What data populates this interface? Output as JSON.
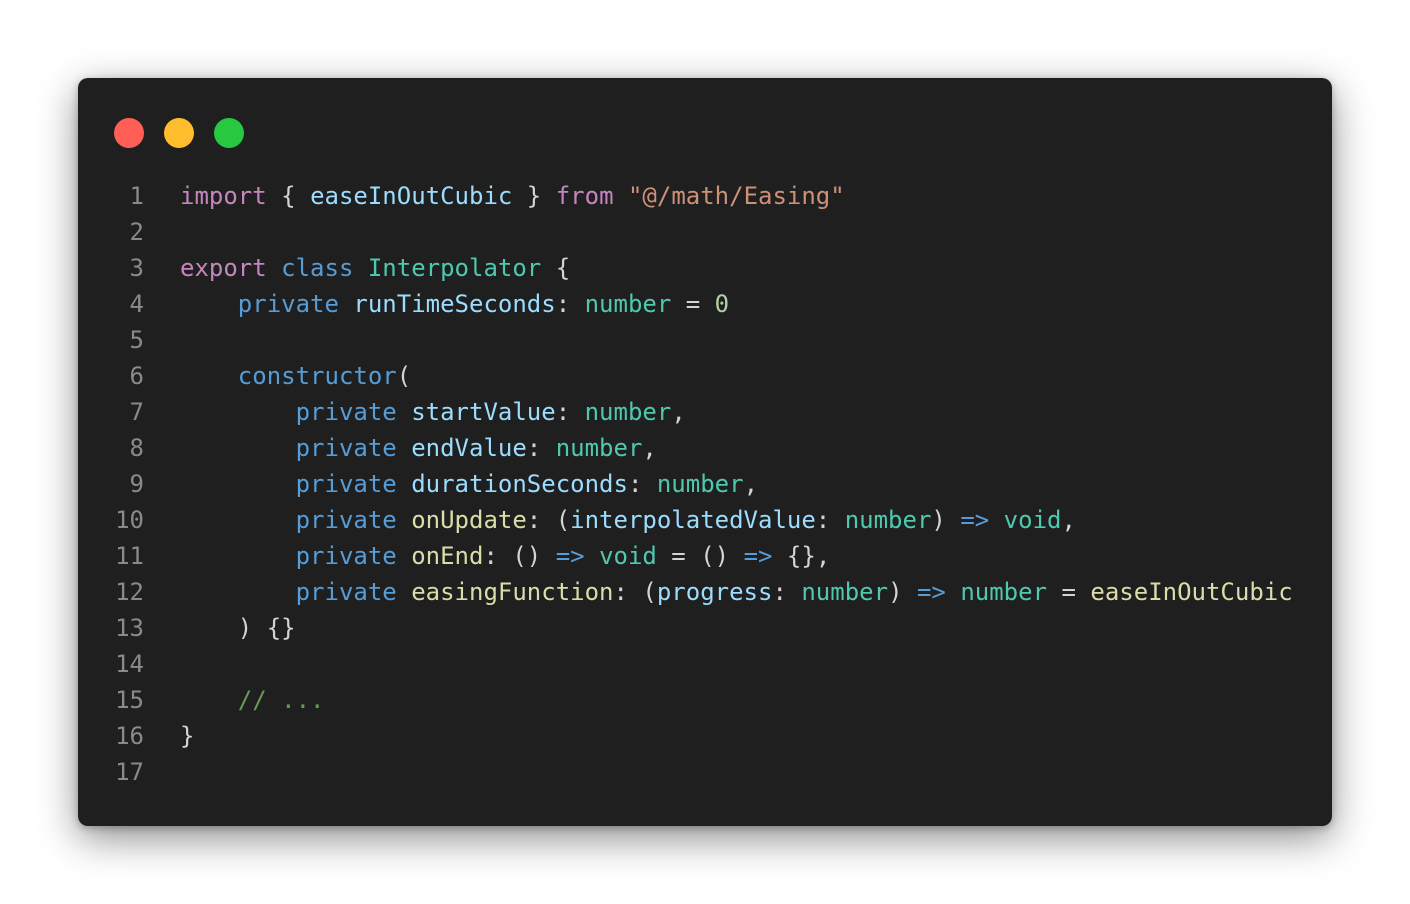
{
  "window_controls": [
    {
      "name": "close",
      "color": "#ff5f57"
    },
    {
      "name": "minimize",
      "color": "#ffbd2e"
    },
    {
      "name": "maximize",
      "color": "#28c840"
    }
  ],
  "colors": {
    "background": "#1f1f1f",
    "line_number": "#8a8a8a",
    "keyword_purple": "#c586c0",
    "keyword_blue": "#569cd6",
    "type_teal": "#4ec9b0",
    "variable": "#9cdcfe",
    "function": "#dcdcaa",
    "string": "#ce9178",
    "number": "#b5cea8",
    "comment": "#6a9955",
    "punctuation": "#d4d4d4"
  },
  "code_lines": [
    {
      "number": "1",
      "tokens": [
        {
          "text": "import",
          "color": "#c586c0"
        },
        {
          "text": " { ",
          "color": "#d4d4d4"
        },
        {
          "text": "easeInOutCubic",
          "color": "#9cdcfe"
        },
        {
          "text": " } ",
          "color": "#d4d4d4"
        },
        {
          "text": "from",
          "color": "#c586c0"
        },
        {
          "text": " ",
          "color": "#d4d4d4"
        },
        {
          "text": "\"@/math/Easing\"",
          "color": "#ce9178"
        }
      ]
    },
    {
      "number": "2",
      "tokens": []
    },
    {
      "number": "3",
      "tokens": [
        {
          "text": "export",
          "color": "#c586c0"
        },
        {
          "text": " ",
          "color": "#d4d4d4"
        },
        {
          "text": "class",
          "color": "#569cd6"
        },
        {
          "text": " ",
          "color": "#d4d4d4"
        },
        {
          "text": "Interpolator",
          "color": "#4ec9b0"
        },
        {
          "text": " {",
          "color": "#d4d4d4"
        }
      ]
    },
    {
      "number": "4",
      "tokens": [
        {
          "text": "    ",
          "color": "#d4d4d4"
        },
        {
          "text": "private",
          "color": "#569cd6"
        },
        {
          "text": " ",
          "color": "#d4d4d4"
        },
        {
          "text": "runTimeSeconds",
          "color": "#9cdcfe"
        },
        {
          "text": ": ",
          "color": "#d4d4d4"
        },
        {
          "text": "number",
          "color": "#4ec9b0"
        },
        {
          "text": " = ",
          "color": "#d4d4d4"
        },
        {
          "text": "0",
          "color": "#b5cea8"
        }
      ]
    },
    {
      "number": "5",
      "tokens": []
    },
    {
      "number": "6",
      "tokens": [
        {
          "text": "    ",
          "color": "#d4d4d4"
        },
        {
          "text": "constructor",
          "color": "#569cd6"
        },
        {
          "text": "(",
          "color": "#d4d4d4"
        }
      ]
    },
    {
      "number": "7",
      "tokens": [
        {
          "text": "        ",
          "color": "#d4d4d4"
        },
        {
          "text": "private",
          "color": "#569cd6"
        },
        {
          "text": " ",
          "color": "#d4d4d4"
        },
        {
          "text": "startValue",
          "color": "#9cdcfe"
        },
        {
          "text": ": ",
          "color": "#d4d4d4"
        },
        {
          "text": "number",
          "color": "#4ec9b0"
        },
        {
          "text": ",",
          "color": "#d4d4d4"
        }
      ]
    },
    {
      "number": "8",
      "tokens": [
        {
          "text": "        ",
          "color": "#d4d4d4"
        },
        {
          "text": "private",
          "color": "#569cd6"
        },
        {
          "text": " ",
          "color": "#d4d4d4"
        },
        {
          "text": "endValue",
          "color": "#9cdcfe"
        },
        {
          "text": ": ",
          "color": "#d4d4d4"
        },
        {
          "text": "number",
          "color": "#4ec9b0"
        },
        {
          "text": ",",
          "color": "#d4d4d4"
        }
      ]
    },
    {
      "number": "9",
      "tokens": [
        {
          "text": "        ",
          "color": "#d4d4d4"
        },
        {
          "text": "private",
          "color": "#569cd6"
        },
        {
          "text": " ",
          "color": "#d4d4d4"
        },
        {
          "text": "durationSeconds",
          "color": "#9cdcfe"
        },
        {
          "text": ": ",
          "color": "#d4d4d4"
        },
        {
          "text": "number",
          "color": "#4ec9b0"
        },
        {
          "text": ",",
          "color": "#d4d4d4"
        }
      ]
    },
    {
      "number": "10",
      "tokens": [
        {
          "text": "        ",
          "color": "#d4d4d4"
        },
        {
          "text": "private",
          "color": "#569cd6"
        },
        {
          "text": " ",
          "color": "#d4d4d4"
        },
        {
          "text": "onUpdate",
          "color": "#dcdcaa"
        },
        {
          "text": ": (",
          "color": "#d4d4d4"
        },
        {
          "text": "interpolatedValue",
          "color": "#9cdcfe"
        },
        {
          "text": ": ",
          "color": "#d4d4d4"
        },
        {
          "text": "number",
          "color": "#4ec9b0"
        },
        {
          "text": ") ",
          "color": "#d4d4d4"
        },
        {
          "text": "=>",
          "color": "#569cd6"
        },
        {
          "text": " ",
          "color": "#d4d4d4"
        },
        {
          "text": "void",
          "color": "#4ec9b0"
        },
        {
          "text": ",",
          "color": "#d4d4d4"
        }
      ]
    },
    {
      "number": "11",
      "tokens": [
        {
          "text": "        ",
          "color": "#d4d4d4"
        },
        {
          "text": "private",
          "color": "#569cd6"
        },
        {
          "text": " ",
          "color": "#d4d4d4"
        },
        {
          "text": "onEnd",
          "color": "#dcdcaa"
        },
        {
          "text": ": () ",
          "color": "#d4d4d4"
        },
        {
          "text": "=>",
          "color": "#569cd6"
        },
        {
          "text": " ",
          "color": "#d4d4d4"
        },
        {
          "text": "void",
          "color": "#4ec9b0"
        },
        {
          "text": " = () ",
          "color": "#d4d4d4"
        },
        {
          "text": "=>",
          "color": "#569cd6"
        },
        {
          "text": " {},",
          "color": "#d4d4d4"
        }
      ]
    },
    {
      "number": "12",
      "tokens": [
        {
          "text": "        ",
          "color": "#d4d4d4"
        },
        {
          "text": "private",
          "color": "#569cd6"
        },
        {
          "text": " ",
          "color": "#d4d4d4"
        },
        {
          "text": "easingFunction",
          "color": "#dcdcaa"
        },
        {
          "text": ": (",
          "color": "#d4d4d4"
        },
        {
          "text": "progress",
          "color": "#9cdcfe"
        },
        {
          "text": ": ",
          "color": "#d4d4d4"
        },
        {
          "text": "number",
          "color": "#4ec9b0"
        },
        {
          "text": ") ",
          "color": "#d4d4d4"
        },
        {
          "text": "=>",
          "color": "#569cd6"
        },
        {
          "text": " ",
          "color": "#d4d4d4"
        },
        {
          "text": "number",
          "color": "#4ec9b0"
        },
        {
          "text": " = ",
          "color": "#d4d4d4"
        },
        {
          "text": "easeInOutCubic",
          "color": "#dcdcaa"
        }
      ]
    },
    {
      "number": "13",
      "tokens": [
        {
          "text": "    ) {}",
          "color": "#d4d4d4"
        }
      ]
    },
    {
      "number": "14",
      "tokens": []
    },
    {
      "number": "15",
      "tokens": [
        {
          "text": "    ",
          "color": "#d4d4d4"
        },
        {
          "text": "// ...",
          "color": "#6a9955"
        }
      ]
    },
    {
      "number": "16",
      "tokens": [
        {
          "text": "}",
          "color": "#d4d4d4"
        }
      ]
    },
    {
      "number": "17",
      "tokens": []
    }
  ]
}
